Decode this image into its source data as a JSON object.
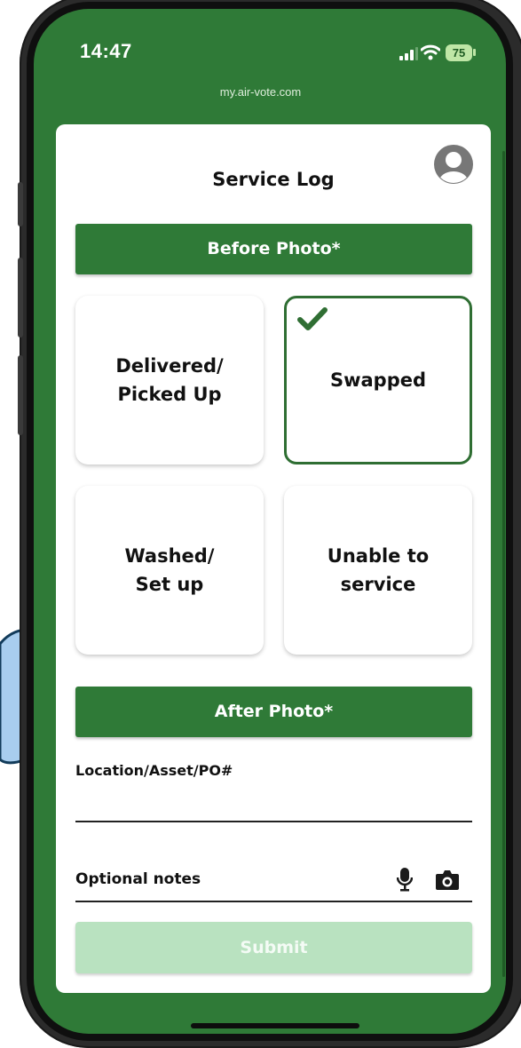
{
  "status_bar": {
    "time": "14:47",
    "battery": "75",
    "url": "my.air-vote.com"
  },
  "page": {
    "title": "Service Log"
  },
  "before_photo": {
    "label": "Before Photo*"
  },
  "options": [
    {
      "label": "Delivered/\nPicked Up",
      "selected": false
    },
    {
      "label": "Swapped",
      "selected": true
    },
    {
      "label": "Washed/\nSet up",
      "selected": false
    },
    {
      "label": "Unable to\nservice",
      "selected": false
    }
  ],
  "after_photo": {
    "label": "After Photo*"
  },
  "location_field": {
    "label": "Location/Asset/PO#",
    "value": ""
  },
  "notes_field": {
    "placeholder": "Optional notes",
    "value": ""
  },
  "submit": {
    "label": "Submit",
    "enabled": false
  },
  "colors": {
    "brand_green": "#2f7a37",
    "submit_disabled": "#b9e2c0",
    "check": "#2f6e33"
  },
  "icons": [
    "signal-icon",
    "wifi-icon",
    "battery-icon",
    "avatar-icon",
    "checkmark-icon",
    "microphone-icon",
    "camera-icon"
  ]
}
